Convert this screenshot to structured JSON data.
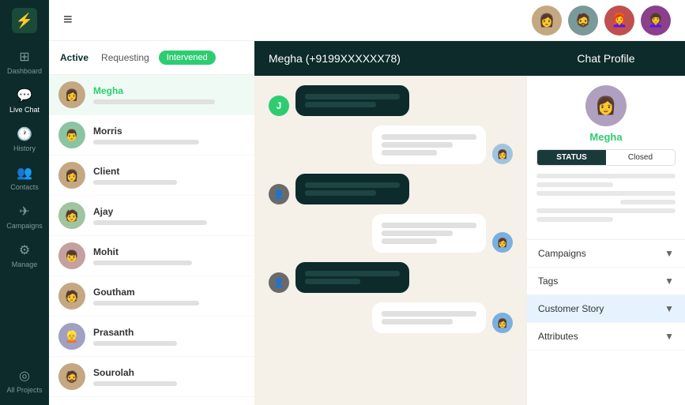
{
  "sidebar": {
    "logo": "⚡",
    "items": [
      {
        "id": "dashboard",
        "label": "Dashboard",
        "icon": "⊞",
        "active": false
      },
      {
        "id": "live-chat",
        "label": "Live Chat",
        "icon": "💬",
        "active": true
      },
      {
        "id": "history",
        "label": "History",
        "icon": "🕐",
        "active": false
      },
      {
        "id": "contacts",
        "label": "Contacts",
        "icon": "👥",
        "active": false
      },
      {
        "id": "campaigns",
        "label": "Campaigns",
        "icon": "✈",
        "active": false
      },
      {
        "id": "manage",
        "label": "Manage",
        "icon": "⚙",
        "active": false
      },
      {
        "id": "all-projects",
        "label": "All Projects",
        "icon": "◎",
        "active": false
      }
    ]
  },
  "contact_tabs": {
    "active_label": "Active",
    "requesting_label": "Requesting",
    "intervened_label": "Intervened"
  },
  "contacts": [
    {
      "name": "Megha",
      "preview_width": "80%",
      "highlighted": true,
      "avatar_color": "#c4a882",
      "emoji": "👩"
    },
    {
      "name": "Morris",
      "preview_width": "70%",
      "highlighted": false,
      "avatar_color": "#8bc4a0",
      "emoji": "👨"
    },
    {
      "name": "Client",
      "preview_width": "60%",
      "highlighted": false,
      "avatar_color": "#c4a882",
      "emoji": "👩"
    },
    {
      "name": "Ajay",
      "preview_width": "75%",
      "highlighted": false,
      "avatar_color": "#a0c4a0",
      "emoji": "🧑"
    },
    {
      "name": "Mohit",
      "preview_width": "65%",
      "highlighted": false,
      "avatar_color": "#c4a0a0",
      "emoji": "👦"
    },
    {
      "name": "Goutham",
      "preview_width": "70%",
      "highlighted": false,
      "avatar_color": "#c4a882",
      "emoji": "🧑"
    },
    {
      "name": "Prasanth",
      "preview_width": "60%",
      "highlighted": false,
      "avatar_color": "#a0a0c4",
      "emoji": "👱"
    },
    {
      "name": "Sourolah",
      "preview_width": "55%",
      "highlighted": false,
      "avatar_color": "#c4a882",
      "emoji": "🧔"
    }
  ],
  "chat": {
    "header_title": "Megha (+9199XXXXXX78)",
    "messages": [
      {
        "type": "incoming",
        "avatar": "J",
        "lines": 1,
        "dark": true
      },
      {
        "type": "outgoing",
        "avatar": "",
        "lines": 2,
        "dark": false
      },
      {
        "type": "incoming",
        "avatar": "",
        "lines": 1,
        "dark": true
      },
      {
        "type": "outgoing",
        "avatar": "",
        "lines": 3,
        "dark": false
      },
      {
        "type": "incoming",
        "avatar": "",
        "lines": 1,
        "dark": true
      },
      {
        "type": "outgoing",
        "avatar": "",
        "lines": 2,
        "dark": false
      }
    ]
  },
  "profile": {
    "header_title": "Chat Profile",
    "name": "Megha",
    "status_label": "STATUS",
    "status_value": "Closed",
    "dropdowns": [
      {
        "label": "Campaigns"
      },
      {
        "label": "Tags"
      },
      {
        "label": "Customer Story",
        "highlighted": true
      },
      {
        "label": "Attributes"
      }
    ]
  },
  "topbar_avatars": [
    "👩",
    "🧔",
    "👩‍🦰",
    "👩‍🦱"
  ],
  "hamburger_icon": "≡"
}
